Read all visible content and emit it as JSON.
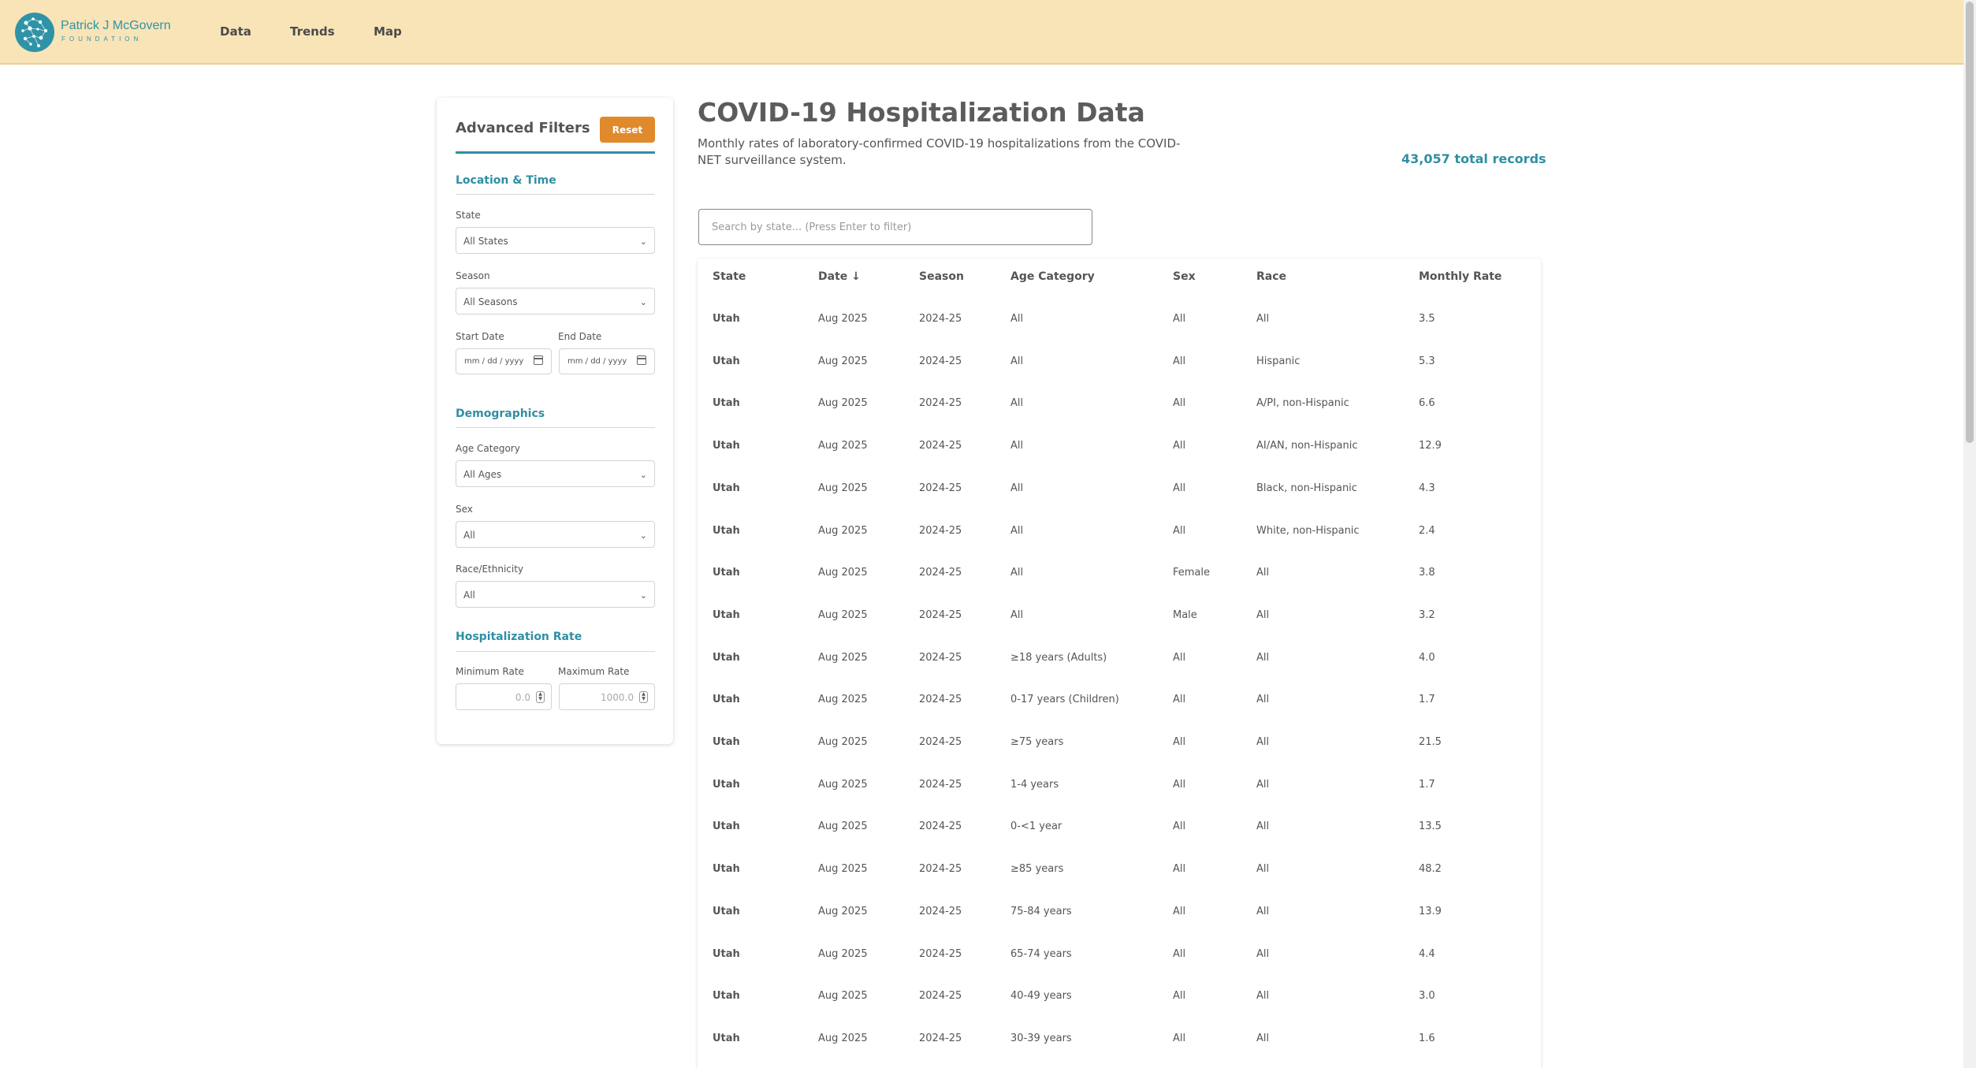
{
  "header": {
    "logo": {
      "line1": "Patrick J McGovern",
      "line2": "FOUNDATION"
    },
    "nav": [
      "Data",
      "Trends",
      "Map"
    ]
  },
  "filters": {
    "title": "Advanced Filters",
    "reset_label": "Reset",
    "location_time": {
      "title": "Location & Time",
      "state_label": "State",
      "state_value": "All States",
      "season_label": "Season",
      "season_value": "All Seasons",
      "start_date_label": "Start Date",
      "end_date_label": "End Date",
      "date_placeholder": "mm / dd / yyyy"
    },
    "demographics": {
      "title": "Demographics",
      "age_label": "Age Category",
      "age_value": "All Ages",
      "sex_label": "Sex",
      "sex_value": "All",
      "race_label": "Race/Ethnicity",
      "race_value": "All"
    },
    "rate": {
      "title": "Hospitalization Rate",
      "min_label": "Minimum Rate",
      "max_label": "Maximum Rate",
      "min_value": "0.0",
      "max_value": "1000.0"
    }
  },
  "main": {
    "title": "COVID-19 Hospitalization Data",
    "description": "Monthly rates of laboratory-confirmed COVID-19 hospitalizations from the COVID-NET surveillance system.",
    "total_records": "43,057 total records",
    "search_placeholder": "Search by state... (Press Enter to filter)"
  },
  "table": {
    "columns": [
      "State",
      "Date ↓",
      "Season",
      "Age Category",
      "Sex",
      "Race",
      "Monthly Rate"
    ],
    "rows": [
      [
        "Utah",
        "Aug 2025",
        "2024-25",
        "All",
        "All",
        "All",
        "3.5"
      ],
      [
        "Utah",
        "Aug 2025",
        "2024-25",
        "All",
        "All",
        "Hispanic",
        "5.3"
      ],
      [
        "Utah",
        "Aug 2025",
        "2024-25",
        "All",
        "All",
        "A/PI, non-Hispanic",
        "6.6"
      ],
      [
        "Utah",
        "Aug 2025",
        "2024-25",
        "All",
        "All",
        "AI/AN, non-Hispanic",
        "12.9"
      ],
      [
        "Utah",
        "Aug 2025",
        "2024-25",
        "All",
        "All",
        "Black, non-Hispanic",
        "4.3"
      ],
      [
        "Utah",
        "Aug 2025",
        "2024-25",
        "All",
        "All",
        "White, non-Hispanic",
        "2.4"
      ],
      [
        "Utah",
        "Aug 2025",
        "2024-25",
        "All",
        "Female",
        "All",
        "3.8"
      ],
      [
        "Utah",
        "Aug 2025",
        "2024-25",
        "All",
        "Male",
        "All",
        "3.2"
      ],
      [
        "Utah",
        "Aug 2025",
        "2024-25",
        "≥18 years (Adults)",
        "All",
        "All",
        "4.0"
      ],
      [
        "Utah",
        "Aug 2025",
        "2024-25",
        "0-17 years (Children)",
        "All",
        "All",
        "1.7"
      ],
      [
        "Utah",
        "Aug 2025",
        "2024-25",
        "≥75 years",
        "All",
        "All",
        "21.5"
      ],
      [
        "Utah",
        "Aug 2025",
        "2024-25",
        "1-4 years",
        "All",
        "All",
        "1.7"
      ],
      [
        "Utah",
        "Aug 2025",
        "2024-25",
        "0-<1 year",
        "All",
        "All",
        "13.5"
      ],
      [
        "Utah",
        "Aug 2025",
        "2024-25",
        "≥85 years",
        "All",
        "All",
        "48.2"
      ],
      [
        "Utah",
        "Aug 2025",
        "2024-25",
        "75-84 years",
        "All",
        "All",
        "13.9"
      ],
      [
        "Utah",
        "Aug 2025",
        "2024-25",
        "65-74 years",
        "All",
        "All",
        "4.4"
      ],
      [
        "Utah",
        "Aug 2025",
        "2024-25",
        "40-49 years",
        "All",
        "All",
        "3.0"
      ],
      [
        "Utah",
        "Aug 2025",
        "2024-25",
        "30-39 years",
        "All",
        "All",
        "1.6"
      ]
    ]
  },
  "colors": {
    "accent": "#2f8fa3",
    "header_bg": "#f9e4b7",
    "reset_button": "#e08a2b"
  }
}
